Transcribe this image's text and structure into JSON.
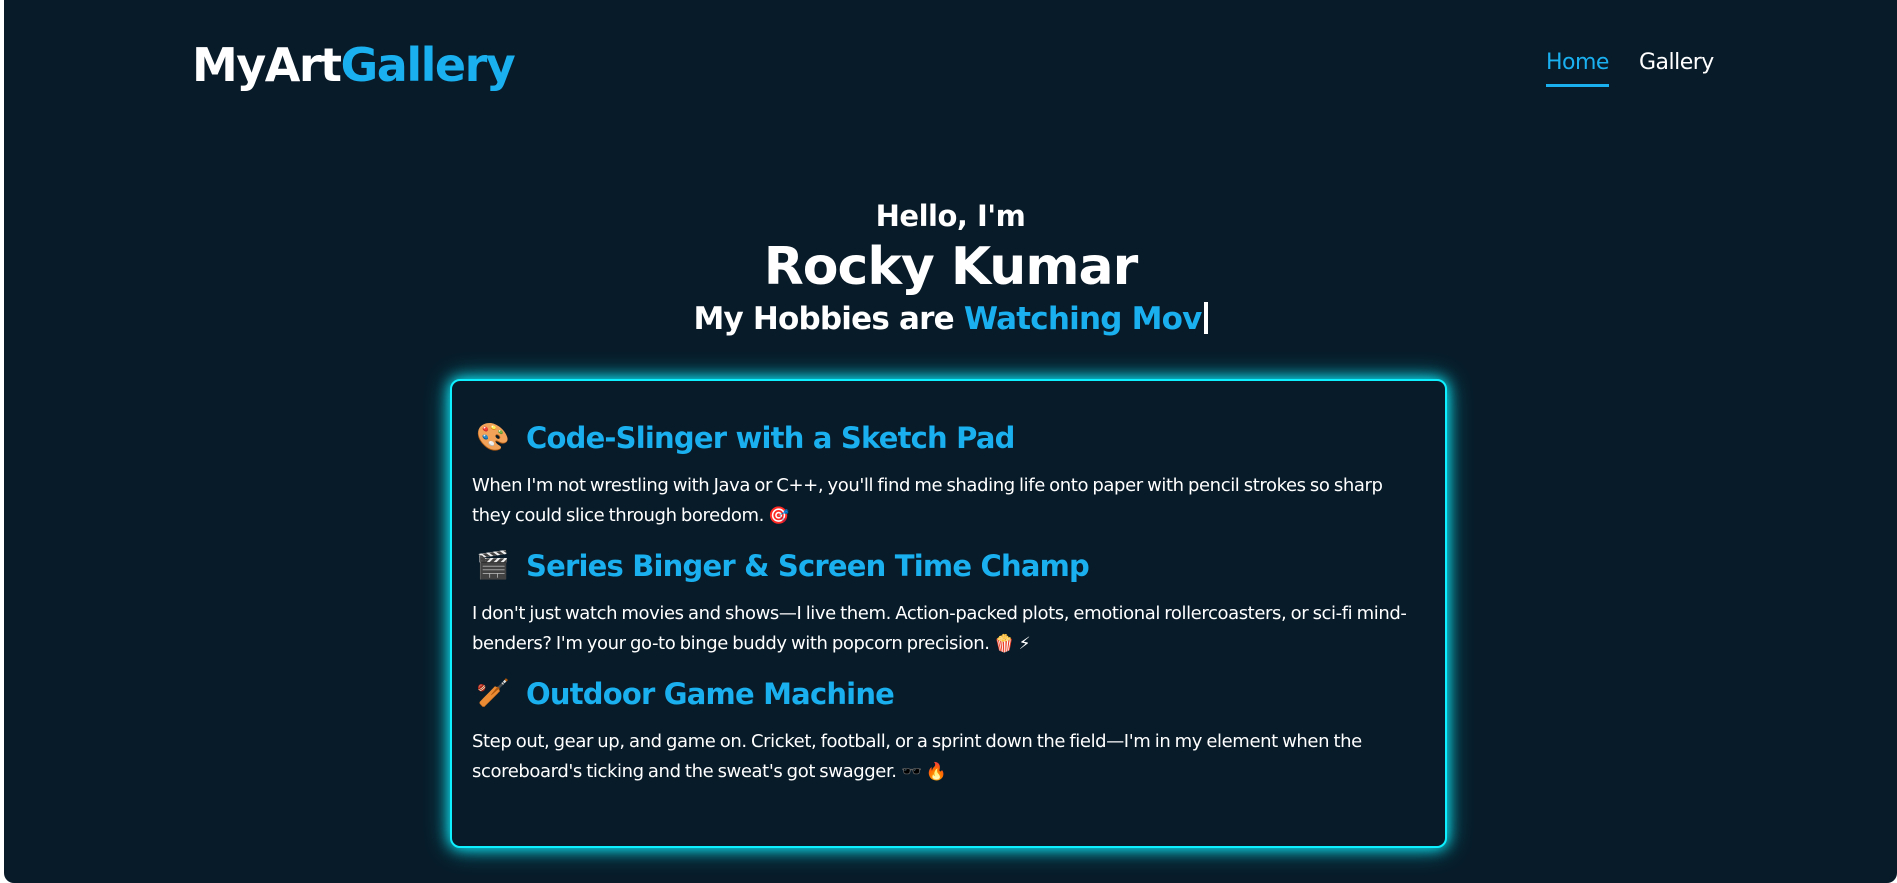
{
  "header": {
    "logo_part1": "MyArt",
    "logo_part2": "Gallery",
    "nav": [
      {
        "label": "Home",
        "active": true
      },
      {
        "label": "Gallery",
        "active": false
      }
    ]
  },
  "hero": {
    "greeting": "Hello, I'm",
    "name": "Rocky Kumar",
    "hobbies_prefix": "My Hobbies are ",
    "hobbies_typed": "Watching Mov"
  },
  "card": {
    "sections": [
      {
        "icon": "palette-icon",
        "emoji": "🎨",
        "title": "Code-Slinger with a Sketch Pad",
        "text": "When I'm not wrestling with Java or C++, you'll find me shading life onto paper with pencil strokes so sharp they could slice through boredom.",
        "trail_emoji": "🎯"
      },
      {
        "icon": "clapperboard-icon",
        "emoji": "🎬",
        "title": "Series Binger & Screen Time Champ",
        "text": "I don't just watch movies and shows—I live them. Action-packed plots, emotional rollercoasters, or sci-fi mind-benders? I'm your go-to binge buddy with popcorn precision.",
        "trail_emoji": "🍿 ⚡"
      },
      {
        "icon": "cricket-bat-icon",
        "emoji": "🏏",
        "title": "Outdoor Game Machine",
        "text": "Step out, gear up, and game on. Cricket, football, or a sprint down the field—I'm in my element when the scoreboard's ticking and the sweat's got swagger.",
        "trail_emoji": "🕶️ 🔥"
      }
    ]
  },
  "colors": {
    "background": "#081b29",
    "accent": "#1ab0f0",
    "glow": "#0ef0ff"
  }
}
